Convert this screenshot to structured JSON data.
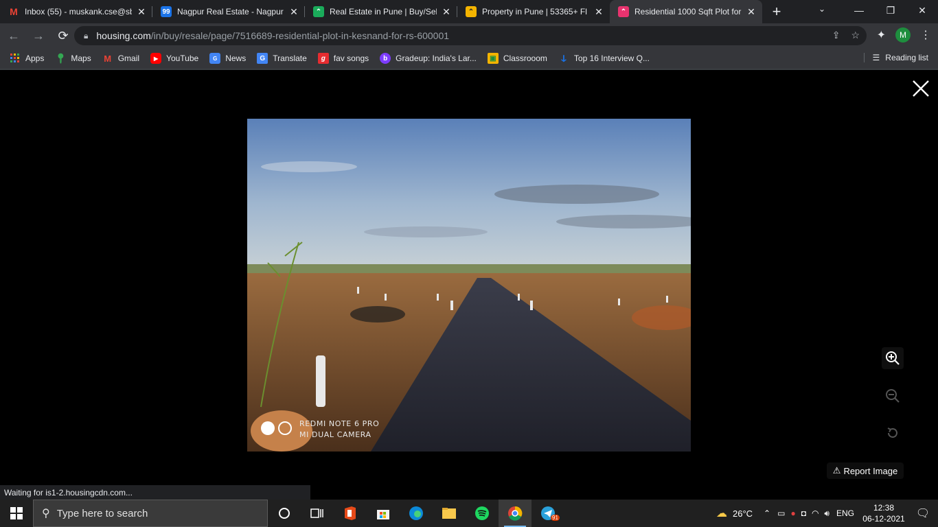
{
  "browser": {
    "tabs": [
      {
        "title": "Inbox (55) - muskank.cse@sb",
        "favicon": "gmail-icon",
        "color": "#d93025",
        "glyph": "M"
      },
      {
        "title": "Nagpur Real Estate - Nagpur",
        "favicon": "99acres-icon",
        "color": "#1a73e8",
        "glyph": "99"
      },
      {
        "title": "Real Estate in Pune | Buy/Sell",
        "favicon": "housing-green-icon",
        "color": "#1aab5a",
        "glyph": "^"
      },
      {
        "title": "Property in Pune | 53365+ Fl",
        "favicon": "housing-yellow-icon",
        "color": "#f4b400",
        "glyph": "^"
      },
      {
        "title": "Residential 1000 Sqft Plot for",
        "favicon": "housing-pink-icon",
        "color": "#e8336f",
        "glyph": "^"
      }
    ],
    "new_tab": "+",
    "url_host": "housing.com",
    "url_path": "/in/buy/resale/page/7516689-residential-plot-in-kesnand-for-rs-600001",
    "profile_initial": "M",
    "bookmarks": [
      {
        "label": "Apps",
        "icon": "apps-grid-icon",
        "color": "#ea4335"
      },
      {
        "label": "Maps",
        "icon": "maps-pin-icon",
        "color": "#34a853"
      },
      {
        "label": "Gmail",
        "icon": "gmail-icon",
        "color": "#d93025"
      },
      {
        "label": "YouTube",
        "icon": "youtube-icon",
        "color": "#ff0000"
      },
      {
        "label": "News",
        "icon": "news-icon",
        "color": "#4285f4"
      },
      {
        "label": "Translate",
        "icon": "translate-icon",
        "color": "#4285f4"
      },
      {
        "label": "fav songs",
        "icon": "gaana-icon",
        "color": "#e72c30"
      },
      {
        "label": "Gradeup: India's Lar...",
        "icon": "gradeup-icon",
        "color": "#7d3cff"
      },
      {
        "label": "Classrooom",
        "icon": "classroom-icon",
        "color": "#f4b400"
      },
      {
        "label": "Top 16 Interview Q...",
        "icon": "pin-icon",
        "color": "#1a73e8"
      }
    ],
    "reading_list": "Reading list",
    "status_text": "Waiting for is1-2.housingcdn.com..."
  },
  "viewer": {
    "watermark_line1": "REDMI NOTE 6 PRO",
    "watermark_line2": "MI DUAL CAMERA",
    "report_label": "Report Image"
  },
  "taskbar": {
    "search_placeholder": "Type here to search",
    "weather": "26°C",
    "language": "ENG",
    "time": "12:38",
    "date": "06-12-2021",
    "telegram_badge": "91"
  }
}
